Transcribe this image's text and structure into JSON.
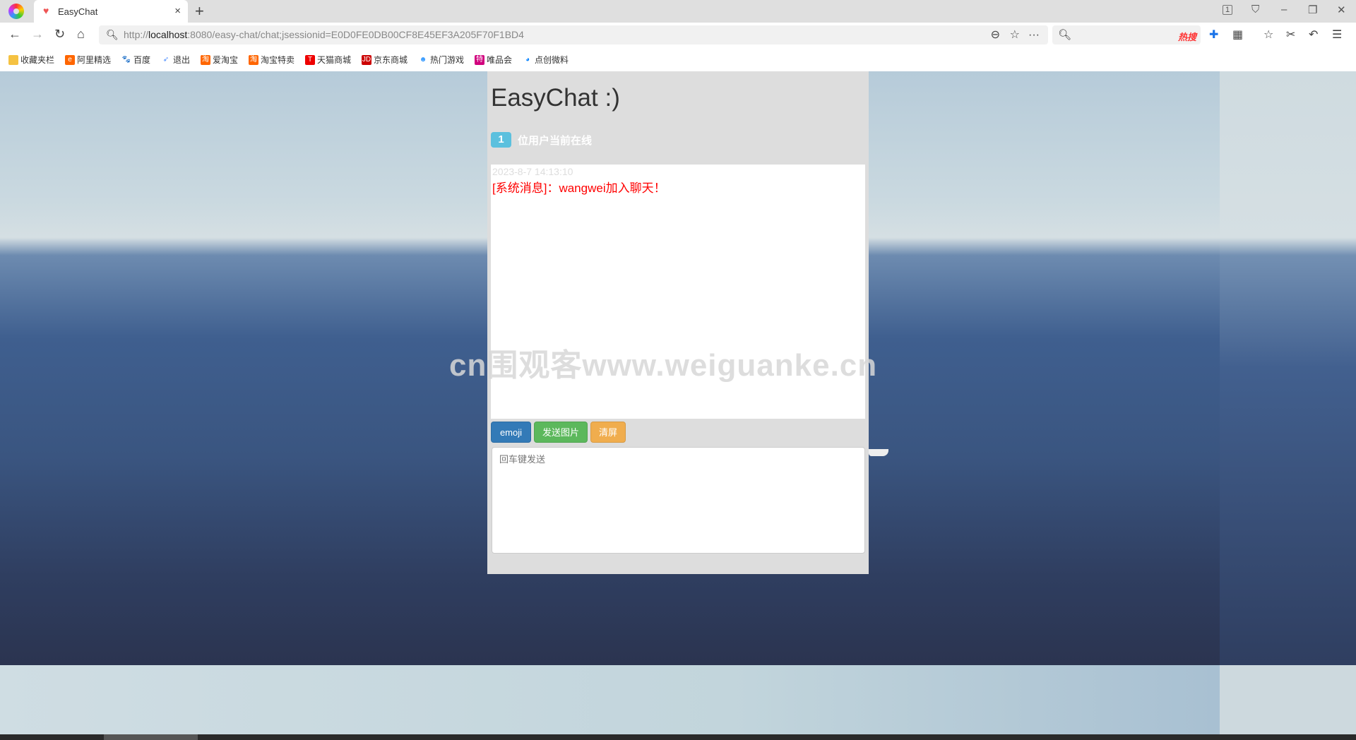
{
  "browser": {
    "tab_title": "EasyChat",
    "url_prefix": "http://",
    "url_host": "localhost",
    "url_rest": ":8080/easy-chat/chat;jsessionid=E0D0FE0DB00CF8E45EF3A205F70F1BD4",
    "tab_count": "1",
    "hot_search": "热搜",
    "bookmarks": [
      "收藏夹栏",
      "阿里精选",
      "百度",
      "退出",
      "爱淘宝",
      "淘宝特卖",
      "天猫商城",
      "京东商城",
      "热门游戏",
      "唯品会",
      "点创微料"
    ]
  },
  "app": {
    "title": "EasyChat :)",
    "online_count": "1",
    "online_label": "位用户当前在线",
    "messages": [
      {
        "time": "2023-8-7 14:13:10",
        "text": "[系统消息]：wangwei加入聊天！"
      }
    ],
    "buttons": {
      "emoji": "emoji",
      "send_image": "发送图片",
      "clear": "清屏"
    },
    "input_placeholder": "回车键发送"
  },
  "watermark": "cn围观客www.weiguanke.cn",
  "colors": {
    "badge": "#5bc0de",
    "emoji": "#337ab7",
    "send_image": "#5cb85c",
    "clear": "#f0ad4e",
    "system_msg": "#ff0000"
  }
}
